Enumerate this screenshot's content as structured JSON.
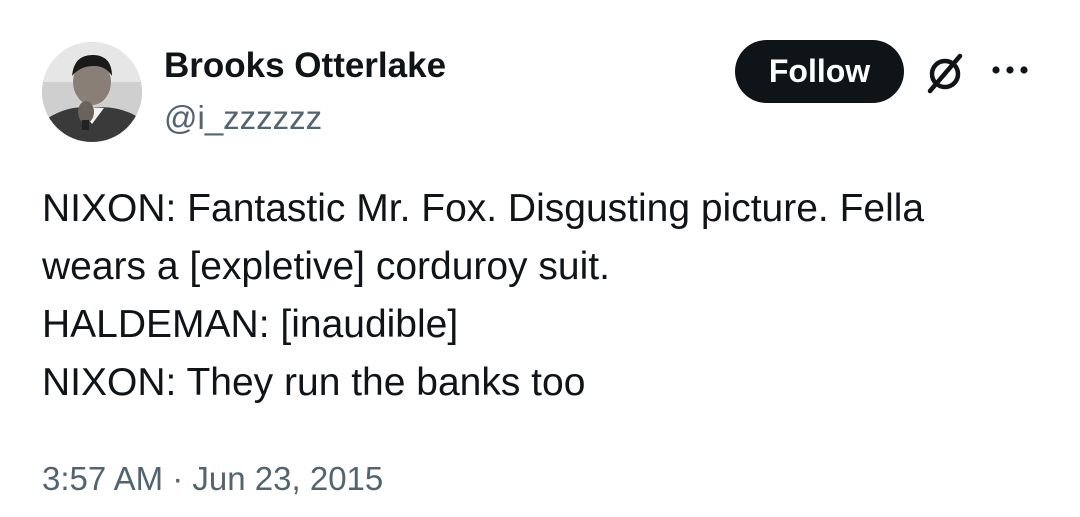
{
  "author": {
    "name": "Brooks Otterlake",
    "handle": "@i_zzzzzz"
  },
  "actions": {
    "follow_label": "Follow",
    "grok_icon": "grok-slash-circle-icon",
    "more_icon": "more-horizontal-icon"
  },
  "tweet": {
    "lines": [
      "NIXON: Fantastic Mr. Fox. Disgusting picture. Fella",
      "wears a [expletive] corduroy suit.",
      "HALDEMAN: [inaudible]",
      "NIXON: They run the banks too"
    ]
  },
  "meta": {
    "time": "3:57 AM",
    "separator": "·",
    "date": "Jun 23, 2015"
  },
  "colors": {
    "text": "#0f1419",
    "secondary": "#536471",
    "button_bg": "#0f1419",
    "button_text": "#ffffff"
  }
}
